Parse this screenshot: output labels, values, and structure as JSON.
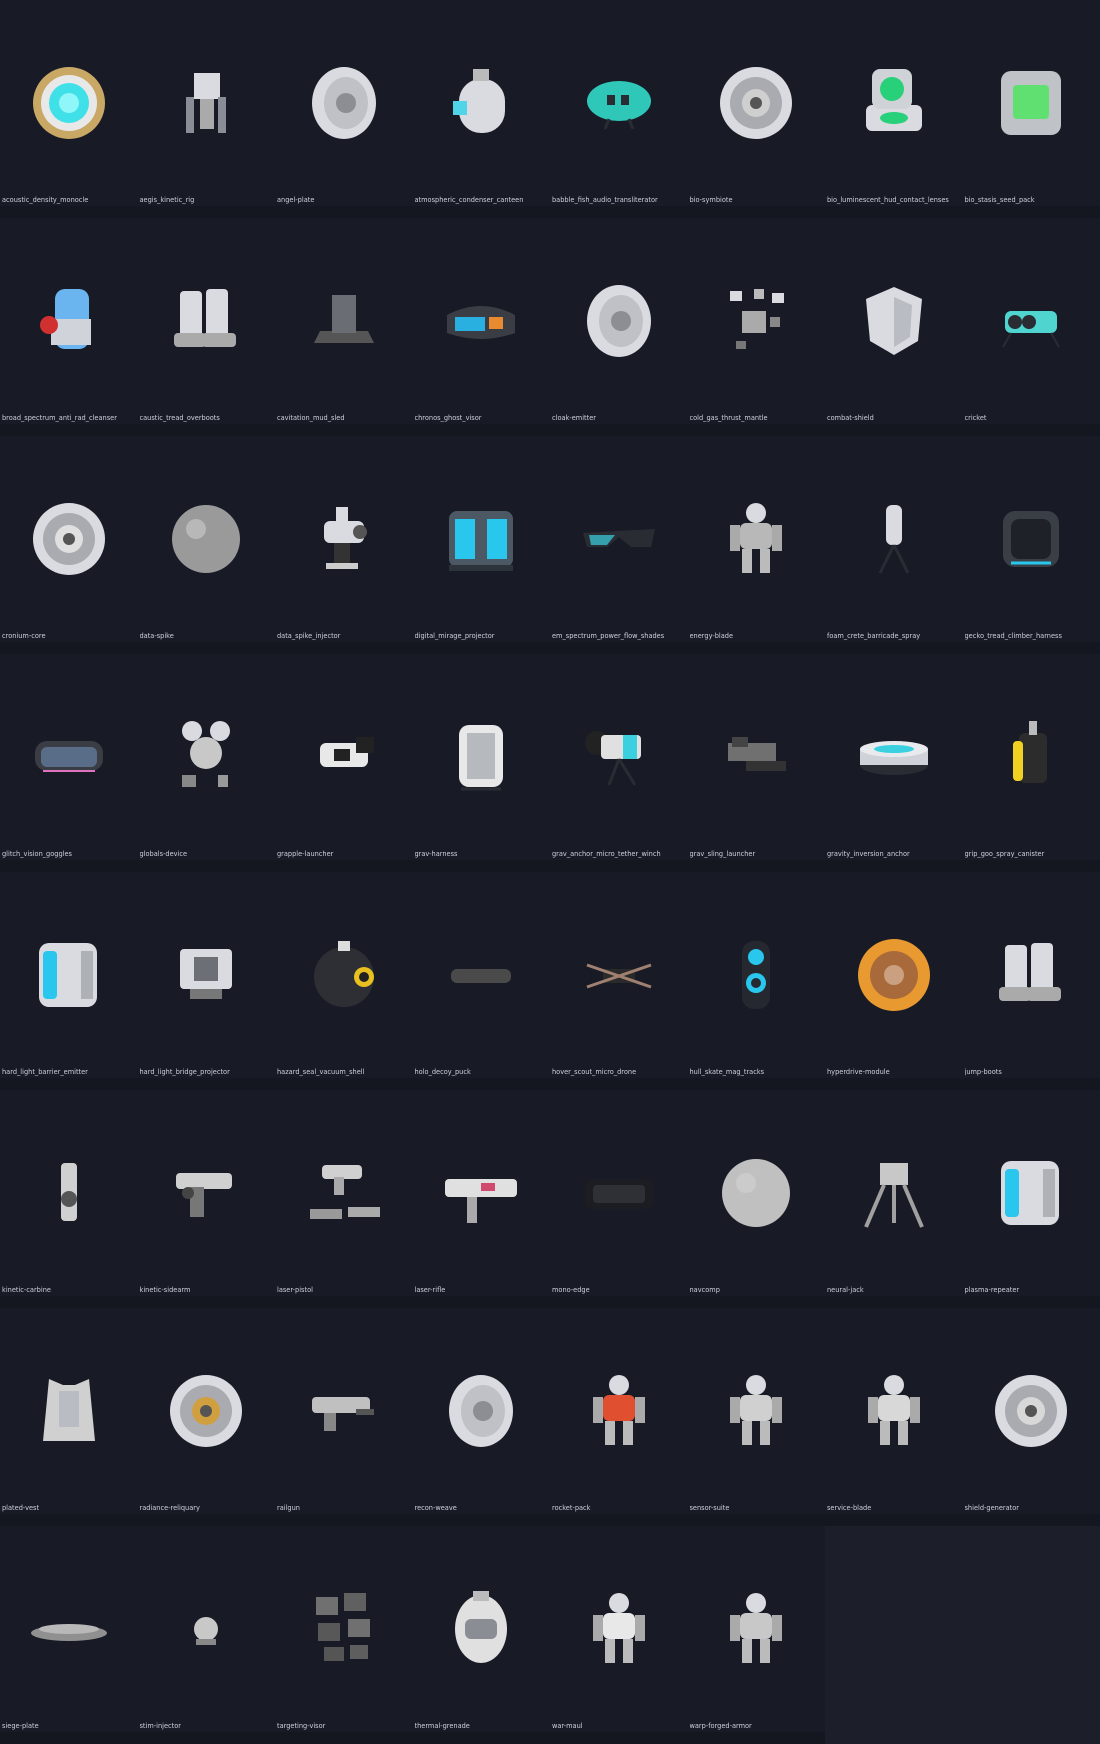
{
  "gallery": {
    "columns": 8,
    "items": [
      {
        "label": "acoustic_density_monocle",
        "icon": "lens-ring",
        "accent": "#3fe0e8"
      },
      {
        "label": "aegis_kinetic_rig",
        "icon": "mech-frame",
        "accent": "#9a9aa2"
      },
      {
        "label": "angel-plate",
        "icon": "disc-plate",
        "accent": "#d8d8d8"
      },
      {
        "label": "atmospheric_condenser_canteen",
        "icon": "canteen",
        "accent": "#4fd4e8"
      },
      {
        "label": "babble_fish_audio_transliterator",
        "icon": "fish-device",
        "accent": "#2fc7b8"
      },
      {
        "label": "bio-symbiote",
        "icon": "turbine-disc",
        "accent": "#cfcfcf"
      },
      {
        "label": "bio_luminescent_hud_contact_lenses",
        "icon": "lens-case",
        "accent": "#29d07a"
      },
      {
        "label": "bio_stasis_seed_pack",
        "icon": "backpack-box",
        "accent": "#5fe070"
      },
      {
        "label": "broad_spectrum_anti_rad_cleanser",
        "icon": "canister",
        "accent": "#6ab4f0"
      },
      {
        "label": "caustic_tread_overboots",
        "icon": "boots",
        "accent": "#cfcfcf"
      },
      {
        "label": "cavitation_mud_sled",
        "icon": "sled",
        "accent": "#b0b0b0"
      },
      {
        "label": "chronos_ghost_visor",
        "icon": "visor",
        "accent": "#2ab0e0"
      },
      {
        "label": "cloak-emitter",
        "icon": "disc-plate",
        "accent": "#e0e0e0"
      },
      {
        "label": "cold_gas_thrust_mantle",
        "icon": "parts-cluster",
        "accent": "#a0a0a0"
      },
      {
        "label": "combat-shield",
        "icon": "shield",
        "accent": "#c8c8c8"
      },
      {
        "label": "cricket",
        "icon": "bug-drone",
        "accent": "#4fd4d0"
      },
      {
        "label": "cronium-core",
        "icon": "turbine-disc",
        "accent": "#e0e0e0"
      },
      {
        "label": "data-spike",
        "icon": "sphere",
        "accent": "#9a9a9a"
      },
      {
        "label": "data_spike_injector",
        "icon": "injector",
        "accent": "#d0d0d0"
      },
      {
        "label": "digital_mirage_projector",
        "icon": "cube-device",
        "accent": "#29c6ee"
      },
      {
        "label": "em_spectrum_power_flow_shades",
        "icon": "shades",
        "accent": "#3ad0e0"
      },
      {
        "label": "energy-blade",
        "icon": "robot",
        "accent": "#b8b8b8"
      },
      {
        "label": "foam_crete_barricade_spray",
        "icon": "tripod-bottle",
        "accent": "#e0e0e0"
      },
      {
        "label": "gecko_tread_climber_harness",
        "icon": "harness",
        "accent": "#29c6ee"
      },
      {
        "label": "glitch_vision_goggles",
        "icon": "goggles",
        "accent": "#3ad0e0"
      },
      {
        "label": "globals-device",
        "icon": "orb-cluster",
        "accent": "#d0d0d0"
      },
      {
        "label": "grapple-launcher",
        "icon": "launcher",
        "accent": "#e8e8e8"
      },
      {
        "label": "grav-harness",
        "icon": "harness-pack",
        "accent": "#e8e8e8"
      },
      {
        "label": "grav_anchor_micro_tether_winch",
        "icon": "winch",
        "accent": "#3ad0e0"
      },
      {
        "label": "grav_sling_launcher",
        "icon": "sling",
        "accent": "#707070"
      },
      {
        "label": "gravity_inversion_anchor",
        "icon": "pad",
        "accent": "#3ad0e0"
      },
      {
        "label": "grip_goo_spray_canister",
        "icon": "spray-can",
        "accent": "#f0d020"
      },
      {
        "label": "hard_light_barrier_emitter",
        "icon": "box-emitter",
        "accent": "#29c6ee"
      },
      {
        "label": "hard_light_bridge_projector",
        "icon": "projector",
        "accent": "#cfcfcf"
      },
      {
        "label": "hazard_seal_vacuum_shell",
        "icon": "bomb",
        "accent": "#e8c020"
      },
      {
        "label": "holo_decoy_puck",
        "icon": "puck",
        "accent": "#4a4a4a"
      },
      {
        "label": "hover_scout_micro_drone",
        "icon": "quad-drone",
        "accent": "#a08070"
      },
      {
        "label": "hull_skate_mag_tracks",
        "icon": "skate-pod",
        "accent": "#29c6ee"
      },
      {
        "label": "hyperdrive-module",
        "icon": "orange-disc",
        "accent": "#e89a30"
      },
      {
        "label": "jump-boots",
        "icon": "boots",
        "accent": "#c0c0c0"
      },
      {
        "label": "kinetic-carbine",
        "icon": "carbine",
        "accent": "#d0d0d0"
      },
      {
        "label": "kinetic-sidearm",
        "icon": "pistol",
        "accent": "#d0d0d0"
      },
      {
        "label": "laser-pistol",
        "icon": "pistol-parts",
        "accent": "#d0d0d0"
      },
      {
        "label": "laser-rifle",
        "icon": "rifle",
        "accent": "#e0e0e0"
      },
      {
        "label": "mono-edge",
        "icon": "black-box",
        "accent": "#505050"
      },
      {
        "label": "navcomp",
        "icon": "sphere",
        "accent": "#c0c0c0"
      },
      {
        "label": "neural-jack",
        "icon": "tripod-walker",
        "accent": "#a0a0a0"
      },
      {
        "label": "plasma-repeater",
        "icon": "box-emitter",
        "accent": "#29c6ee"
      },
      {
        "label": "plated-vest",
        "icon": "vest",
        "accent": "#d0d0d0"
      },
      {
        "label": "radiance-reliquary",
        "icon": "turbine-disc",
        "accent": "#d0a040"
      },
      {
        "label": "railgun",
        "icon": "railgun",
        "accent": "#c0c0c0"
      },
      {
        "label": "recon-weave",
        "icon": "disc-plate",
        "accent": "#d8d8d8"
      },
      {
        "label": "rocket-pack",
        "icon": "robot",
        "accent": "#e05030"
      },
      {
        "label": "sensor-suite",
        "icon": "robot",
        "accent": "#d0d0d0"
      },
      {
        "label": "service-blade",
        "icon": "robot",
        "accent": "#d8d8d8"
      },
      {
        "label": "shield-generator",
        "icon": "turbine-disc",
        "accent": "#d8d8d8"
      },
      {
        "label": "siege-plate",
        "icon": "flat-disc",
        "accent": "#909090"
      },
      {
        "label": "stim-injector",
        "icon": "small-orb",
        "accent": "#c8c8c8"
      },
      {
        "label": "targeting-visor",
        "icon": "parts-grid",
        "accent": "#707070"
      },
      {
        "label": "thermal-grenade",
        "icon": "grenade",
        "accent": "#e0e0e0"
      },
      {
        "label": "war-maul",
        "icon": "robot",
        "accent": "#e8e8e8"
      },
      {
        "label": "warp-forged-armor",
        "icon": "robot",
        "accent": "#c8c8c8"
      }
    ]
  }
}
